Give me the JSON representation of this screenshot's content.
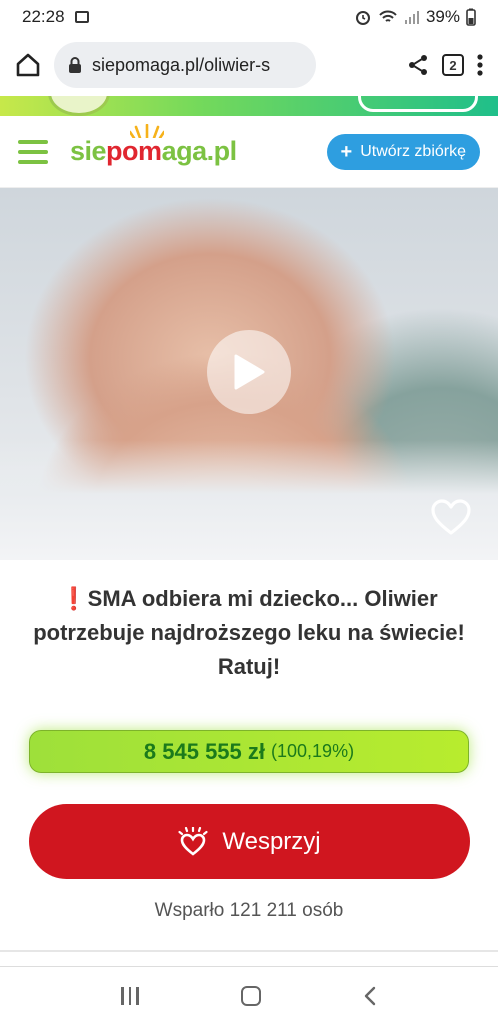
{
  "status_bar": {
    "time": "22:28",
    "battery": "39%",
    "icons": [
      "gallery-icon",
      "alarm-icon",
      "wifi-icon",
      "signal-icon",
      "battery-icon"
    ]
  },
  "browser": {
    "url": "siepomaga.pl/oliwier-s",
    "tab_count": "2",
    "icons": [
      "home-icon",
      "lock-icon",
      "share-icon",
      "tabs-icon",
      "more-icon"
    ]
  },
  "site_header": {
    "logo_parts": {
      "a": "sie",
      "b": "po",
      "c": "m",
      "d": "aga.pl"
    },
    "create_button": "Utwórz zbiórkę",
    "brand_green": "#7cc242",
    "brand_red": "#e0262f",
    "button_blue": "#2e9ee0"
  },
  "campaign": {
    "title_icon": "❗",
    "title": "SMA odbiera mi dziecko... Oliwier potrzebuje najdroższego leku na świecie! Ratuj!",
    "amount": "8 545 555 zł",
    "percent": "(100,19%)",
    "progress_fraction": 1.0,
    "donate_button": "Wesprzyj",
    "supporters": "Wsparło 121 211 osób",
    "media_icons": [
      "play-icon",
      "heart-icon"
    ]
  },
  "colors": {
    "progress_green": "#9ee03a",
    "progress_text": "#1b7a1b",
    "donate_red": "#d0161f"
  }
}
